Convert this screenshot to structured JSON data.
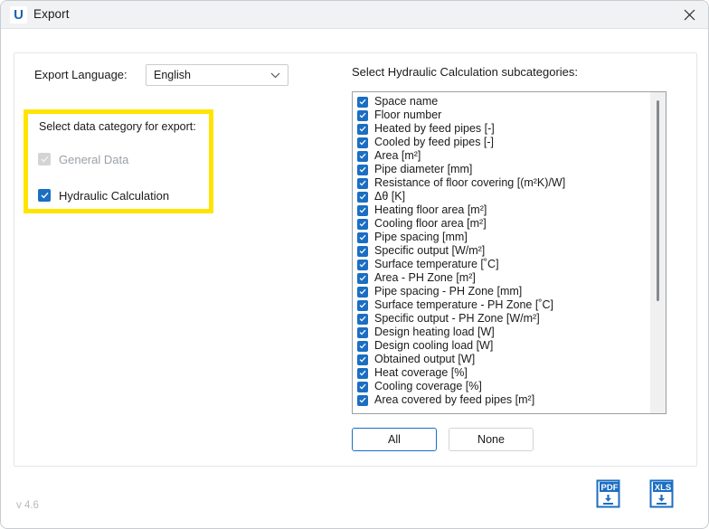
{
  "window": {
    "title": "Export",
    "logo_letter": "U",
    "close_icon": "close-icon",
    "version": "v 4.6"
  },
  "form": {
    "language_label": "Export Language:",
    "language_value": "English",
    "language_options": [
      "English"
    ],
    "chevron_icon": "chevron-down-icon"
  },
  "category_box": {
    "title": "Select data category for export:",
    "highlight_color": "#ffe400",
    "items": [
      {
        "label": "General Data",
        "checked": true,
        "disabled": true
      },
      {
        "label": "Hydraulic Calculation",
        "checked": true,
        "disabled": false
      }
    ]
  },
  "subcategories": {
    "title": "Select Hydraulic Calculation subcategories:",
    "accent_color": "#1b6ec2",
    "items": [
      {
        "label": "Space name",
        "checked": true
      },
      {
        "label": "Floor number",
        "checked": true
      },
      {
        "label": "Heated by feed pipes [-]",
        "checked": true
      },
      {
        "label": "Cooled by feed pipes [-]",
        "checked": true
      },
      {
        "label": "Area [m²]",
        "checked": true
      },
      {
        "label": "Pipe diameter [mm]",
        "checked": true
      },
      {
        "label": "Resistance of floor covering [(m²K)/W]",
        "checked": true
      },
      {
        "label": "Δθ [K]",
        "checked": true
      },
      {
        "label": "Heating floor area [m²]",
        "checked": true
      },
      {
        "label": "Cooling floor area [m²]",
        "checked": true
      },
      {
        "label": "Pipe spacing [mm]",
        "checked": true
      },
      {
        "label": "Specific output [W/m²]",
        "checked": true
      },
      {
        "label": "Surface temperature [˚C]",
        "checked": true
      },
      {
        "label": "Area - PH Zone [m²]",
        "checked": true
      },
      {
        "label": "Pipe spacing - PH Zone [mm]",
        "checked": true
      },
      {
        "label": "Surface temperature - PH Zone [˚C]",
        "checked": true
      },
      {
        "label": "Specific output - PH Zone [W/m²]",
        "checked": true
      },
      {
        "label": "Design heating load [W]",
        "checked": true
      },
      {
        "label": "Design cooling load [W]",
        "checked": true
      },
      {
        "label": "Obtained output [W]",
        "checked": true
      },
      {
        "label": "Heat coverage [%]",
        "checked": true
      },
      {
        "label": "Cooling coverage [%]",
        "checked": true
      },
      {
        "label": "Area covered by feed pipes [m²]",
        "checked": true
      }
    ]
  },
  "selection_buttons": {
    "all_label": "All",
    "none_label": "None"
  },
  "export_icons": [
    {
      "name": "pdf-export-icon",
      "label": "PDF"
    },
    {
      "name": "xls-export-icon",
      "label": "XLS"
    }
  ]
}
